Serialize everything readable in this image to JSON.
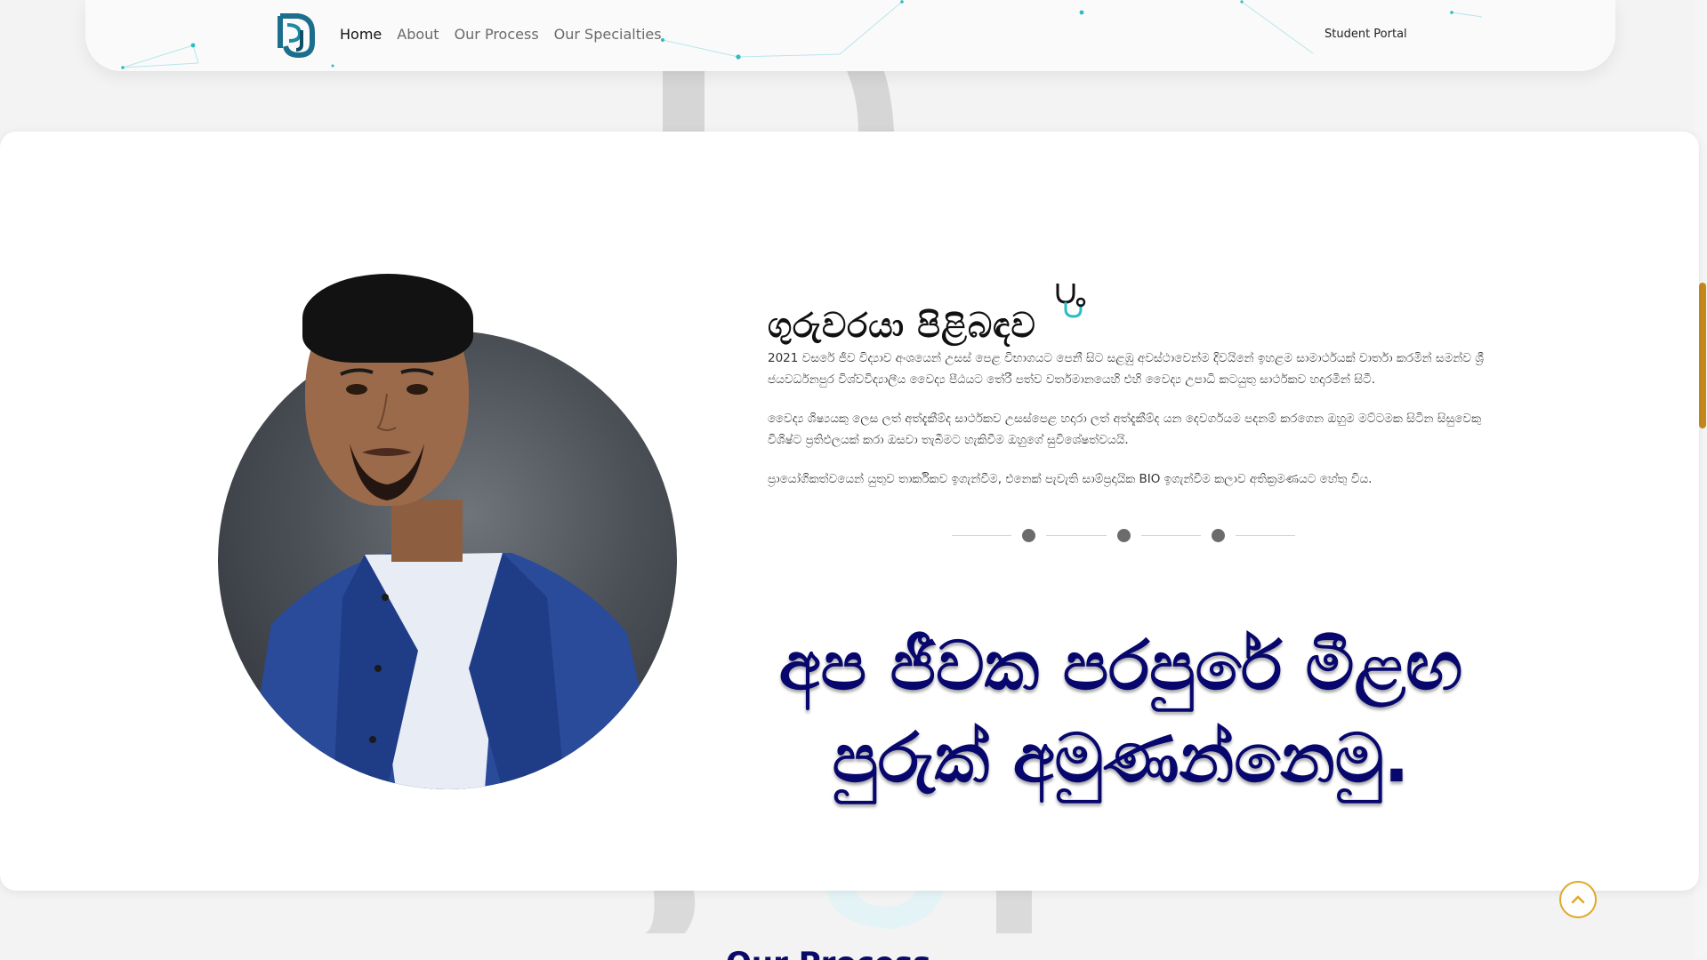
{
  "nav": {
    "links": [
      "Home",
      "About",
      "Our Process",
      "Our Specialties"
    ],
    "portal": "Student Portal"
  },
  "about": {
    "title": "ගුරුවරයා පිළිබඳව",
    "paragraphs": [
      "2021 වසරේ ජීව විද්‍යාව අංශයෙන් උසස් පෙළ විභාගයට පෙනී සිට සළඹු අවස්ථාවෙන්ම දිවයිනේ ඉහළම සාමාර්ථයක් වාර්තා කරමින් සමන්ව ශ්‍රී ජයවර්ධනපුර විශ්වවිද්‍යාලීය වෛද්‍ය පීඨයට තේරී පත්ව වර්තමානයෙහි එහි වෛද්‍ය උපාධි කටයුතු සාර්ථකව හදාරමින් සිටී.",
      "වෛද්‍ය ශිෂ්‍යයකු ලෙස ලත් අත්දැකීම්ද සාර්ථකව උසස්පෙළ හදාරා ලත් අත්දැකීම්ද යන දෙවර්ගයම පදනම් කරගෙන ඔහු​ම මට්ටමක සිටින සිසුවෙකු විශිෂ්ට ප්‍රතිඵලයක් කරා ඔසවා තැබීමට හැකිවීම ඔහුගේ සුවිශේෂත්වයයි.",
      "ප්‍රායෝගිකත්වයෙන් යුතුව තාර්කිකව ඉගැන්වීම, එනෙක් පැවැති සාම්ප්‍රදායික BIO ඉගැන්වීම කලාව අතික්‍රමණයට හේතු විය."
    ],
    "slogan_line1": "අප ජීවක පරපුරේ මීළඟ",
    "slogan_line2": "පුරුක් අමුණන්නෙමු."
  },
  "next_section": {
    "heading_peek": "Our Process"
  },
  "colors": {
    "slogan": "#07076e",
    "logo": "#1b6f8c",
    "accent": "#e1a92a",
    "scrollbar": "#c58a1c",
    "network": "#2bbcc4"
  },
  "icons": {
    "logo": "pj-logo-icon",
    "title_icon": "stethoscope-icon",
    "scroll_top": "chevron-up-icon"
  }
}
